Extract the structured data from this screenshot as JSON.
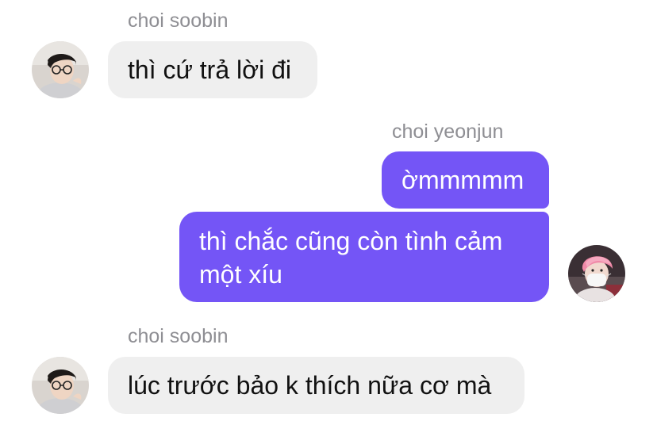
{
  "messages": [
    {
      "sender": "choi soobin",
      "text": "thì cứ trả lời đi"
    },
    {
      "sender": "choi yeonjun",
      "text": "ờmmmmm"
    },
    {
      "text_line1": "thì chắc cũng còn tình cảm",
      "text_line2": "một xíu"
    },
    {
      "sender": "choi soobin",
      "text": "lúc trước bảo k thích nữa cơ mà"
    }
  ],
  "avatars": {
    "soobin": "avatar-photo-soobin",
    "yeonjun": "avatar-photo-yeonjun"
  },
  "colors": {
    "outgoing_bubble": "#7455f6",
    "incoming_bubble": "#efefef",
    "sender_label": "#8e8e93"
  }
}
